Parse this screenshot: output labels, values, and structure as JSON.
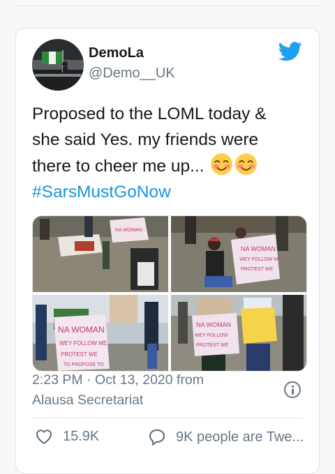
{
  "tweet": {
    "display_name": "DemoLa",
    "handle": "@Demo__UK",
    "text_line1": "Proposed to the LOML today &",
    "text_line2": "she said Yes. my friends were",
    "text_line3": "there to cheer me up...",
    "hashtag": "#SarsMustGoNow",
    "emoji": [
      "smiling-face-with-blush",
      "smiling-face-with-blush"
    ],
    "timestamp": "2:23 PM · Oct 13, 2020 from",
    "location": "Alausa Secretariat"
  },
  "media": {
    "placard_lines": [
      "NA WOMAN",
      "WEY FOLLOW ME",
      "PROTEST WE",
      "TO PROPOSE TO"
    ]
  },
  "actions": {
    "likes": "15.9K",
    "replies_label": "9K people are Twe..."
  },
  "colors": {
    "accent": "#1b95e0",
    "twitter_blue": "#1da1f2",
    "muted": "#657786",
    "text": "#14171a"
  }
}
